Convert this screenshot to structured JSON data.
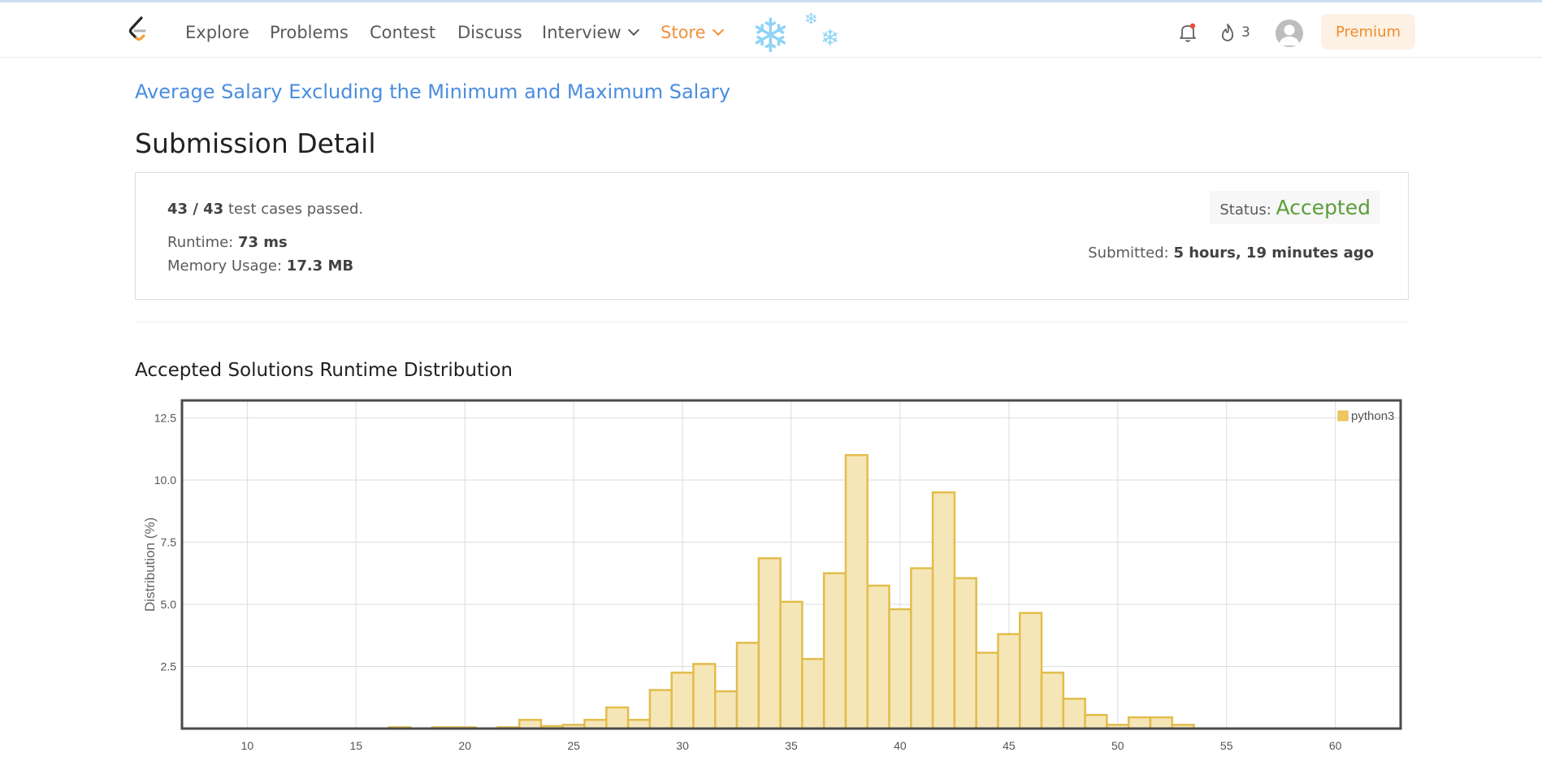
{
  "nav": {
    "explore": "Explore",
    "problems": "Problems",
    "contest": "Contest",
    "discuss": "Discuss",
    "interview": "Interview",
    "store": "Store",
    "streak_count": "3",
    "premium": "Premium"
  },
  "colors": {
    "link": "#4a8de0",
    "accepted": "#5a9e3a",
    "store": "#f0913c",
    "bar_fill": "#f5e6b8",
    "bar_stroke": "#e2bd4b"
  },
  "icons": [
    "leetcode-logo-icon",
    "chevron-down-icon",
    "snowflake-icon",
    "bell-icon",
    "flame-icon",
    "avatar-icon"
  ],
  "problem_title": "Average Salary Excluding the Minimum and Maximum Salary",
  "page_title": "Submission Detail",
  "detail": {
    "passed": "43 / 43",
    "passed_suffix": " test cases passed.",
    "runtime_label": "Runtime: ",
    "runtime_value": "73 ms",
    "memory_label": "Memory Usage: ",
    "memory_value": "17.3 MB",
    "status_label": "Status: ",
    "status_value": "Accepted",
    "submitted_label": "Submitted: ",
    "submitted_value": "5 hours, 19 minutes ago"
  },
  "section_title": "Accepted Solutions Runtime Distribution",
  "chart_data": {
    "type": "bar",
    "ylabel": "Distribution (%)",
    "xlabel": "",
    "xlim": [
      7,
      63
    ],
    "ylim": [
      0,
      13.2
    ],
    "x_ticks": [
      10,
      15,
      20,
      25,
      30,
      35,
      40,
      45,
      50,
      55,
      60
    ],
    "y_ticks": [
      2.5,
      5.0,
      7.5,
      10.0,
      12.5
    ],
    "y_tick_labels": [
      "2.5",
      "5.0",
      "7.5",
      "10.0",
      "12.5"
    ],
    "grid": true,
    "legend_position": "top-right",
    "series": [
      {
        "name": "python3",
        "x": [
          17,
          18,
          19,
          20,
          21,
          22,
          23,
          24,
          25,
          26,
          27,
          28,
          29,
          30,
          31,
          32,
          33,
          34,
          35,
          36,
          37,
          38,
          39,
          40,
          41,
          42,
          43,
          44,
          45,
          46,
          47,
          48,
          49,
          50,
          51,
          52,
          53
        ],
        "values": [
          0.05,
          0,
          0.05,
          0.05,
          0,
          0.05,
          0.35,
          0.1,
          0.15,
          0.35,
          0.85,
          0.35,
          1.55,
          2.25,
          2.6,
          1.5,
          3.45,
          6.85,
          5.1,
          2.8,
          6.25,
          11.0,
          5.75,
          4.8,
          6.45,
          9.5,
          6.05,
          3.05,
          3.8,
          4.65,
          2.25,
          1.2,
          0.55,
          0.15,
          0.45,
          0.45,
          0.15
        ]
      }
    ]
  }
}
